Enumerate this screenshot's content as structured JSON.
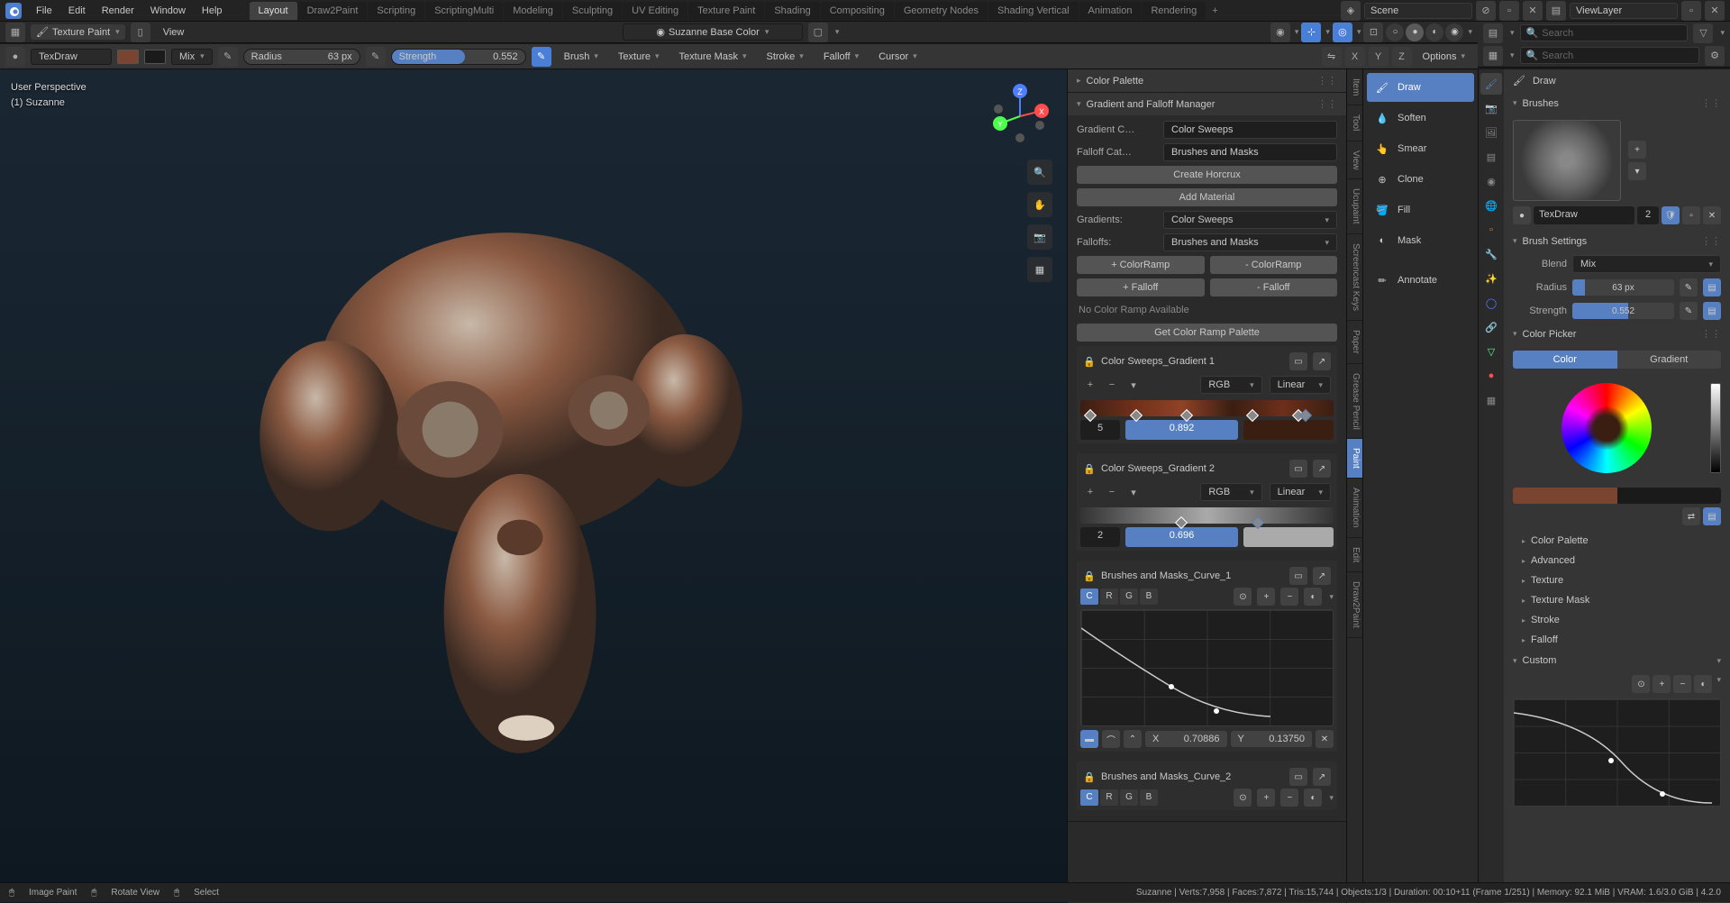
{
  "menubar": [
    "File",
    "Edit",
    "Render",
    "Window",
    "Help"
  ],
  "workspaces": [
    "Layout",
    "Draw2Paint",
    "Scripting",
    "ScriptingMulti",
    "Modeling",
    "Sculpting",
    "UV Editing",
    "Texture Paint",
    "Shading",
    "Compositing",
    "Geometry Nodes",
    "Shading Vertical",
    "Animation",
    "Rendering"
  ],
  "workspace_active": "Layout",
  "scene": {
    "label": "Scene",
    "viewlayer": "ViewLayer"
  },
  "mode": {
    "label": "Texture Paint",
    "view": "View"
  },
  "image_slot": "Suzanne Base Color",
  "toolbar": {
    "brush_name": "TexDraw",
    "blend": "Mix",
    "radius_label": "Radius",
    "radius_value": "63 px",
    "strength_label": "Strength",
    "strength_value": "0.552",
    "menus": [
      "Brush",
      "Texture",
      "Texture Mask",
      "Stroke",
      "Falloff",
      "Cursor"
    ],
    "options": "Options"
  },
  "viewport": {
    "perspective": "User Perspective",
    "object": "(1) Suzanne",
    "axes": {
      "x": "X",
      "y": "Y",
      "z": "Z"
    }
  },
  "npanel": {
    "color_palette": "Color Palette",
    "gradient_manager": "Gradient and Falloff Manager",
    "gradient_cat_label": "Gradient C…",
    "gradient_cat_value": "Color Sweeps",
    "falloff_cat_label": "Falloff Cat…",
    "falloff_cat_value": "Brushes and Masks",
    "create_horcrux": "Create Horcrux",
    "add_material": "Add Material",
    "gradients_label": "Gradients:",
    "gradients_value": "Color Sweeps",
    "falloffs_label": "Falloffs:",
    "falloffs_value": "Brushes and Masks",
    "btn_add_ramp": "+ ColorRamp",
    "btn_del_ramp": "- ColorRamp",
    "btn_add_falloff": "+ Falloff",
    "btn_del_falloff": "- Falloff",
    "no_ramp": "No Color Ramp Available",
    "get_palette": "Get Color Ramp Palette",
    "grad1": {
      "name": "Color Sweeps_Gradient 1",
      "mode": "RGB",
      "interp": "Linear",
      "stops": "5",
      "pos": "0.892"
    },
    "grad2": {
      "name": "Color Sweeps_Gradient 2",
      "mode": "RGB",
      "interp": "Linear",
      "stops": "2",
      "pos": "0.696"
    },
    "curve1": {
      "name": "Brushes and Masks_Curve_1",
      "channels": [
        "C",
        "R",
        "G",
        "B"
      ],
      "x_label": "X",
      "x_val": "0.70886",
      "y_label": "Y",
      "y_val": "0.13750"
    },
    "curve2": {
      "name": "Brushes and Masks_Curve_2",
      "channels": [
        "C",
        "R",
        "G",
        "B"
      ]
    }
  },
  "vtabs": [
    "Item",
    "Tool",
    "View",
    "Ucupaint",
    "Screencast Keys",
    "Paper",
    "Grease Pencil",
    "Paint",
    "Animation",
    "Edit",
    "Draw2Paint"
  ],
  "vtab_active": "Paint",
  "tools": [
    "Draw",
    "Soften",
    "Smear",
    "Clone",
    "Fill",
    "Mask",
    "Annotate"
  ],
  "tool_active": "Draw",
  "right": {
    "draw": "Draw",
    "brushes": "Brushes",
    "brush_name": "TexDraw",
    "brush_count": "2",
    "brush_settings": "Brush Settings",
    "blend_label": "Blend",
    "blend_value": "Mix",
    "radius_label": "Radius",
    "radius_value": "63 px",
    "strength_label": "Strength",
    "strength_value": "0.552",
    "color_picker": "Color Picker",
    "color_tab": "Color",
    "gradient_tab": "Gradient",
    "subsections": [
      "Color Palette",
      "Advanced",
      "Texture",
      "Texture Mask",
      "Stroke",
      "Falloff"
    ],
    "custom": "Custom",
    "search_placeholder": "Search"
  },
  "status": {
    "tool": "Image Paint",
    "rotate": "Rotate View",
    "select": "Select",
    "stats": "Suzanne | Verts:7,958 | Faces:7,872 | Tris:15,744 | Objects:1/3 | Duration: 00:10+11 (Frame 1/251) | Memory: 92.1 MiB | VRAM: 1.6/3.0 GiB | 4.2.0"
  }
}
